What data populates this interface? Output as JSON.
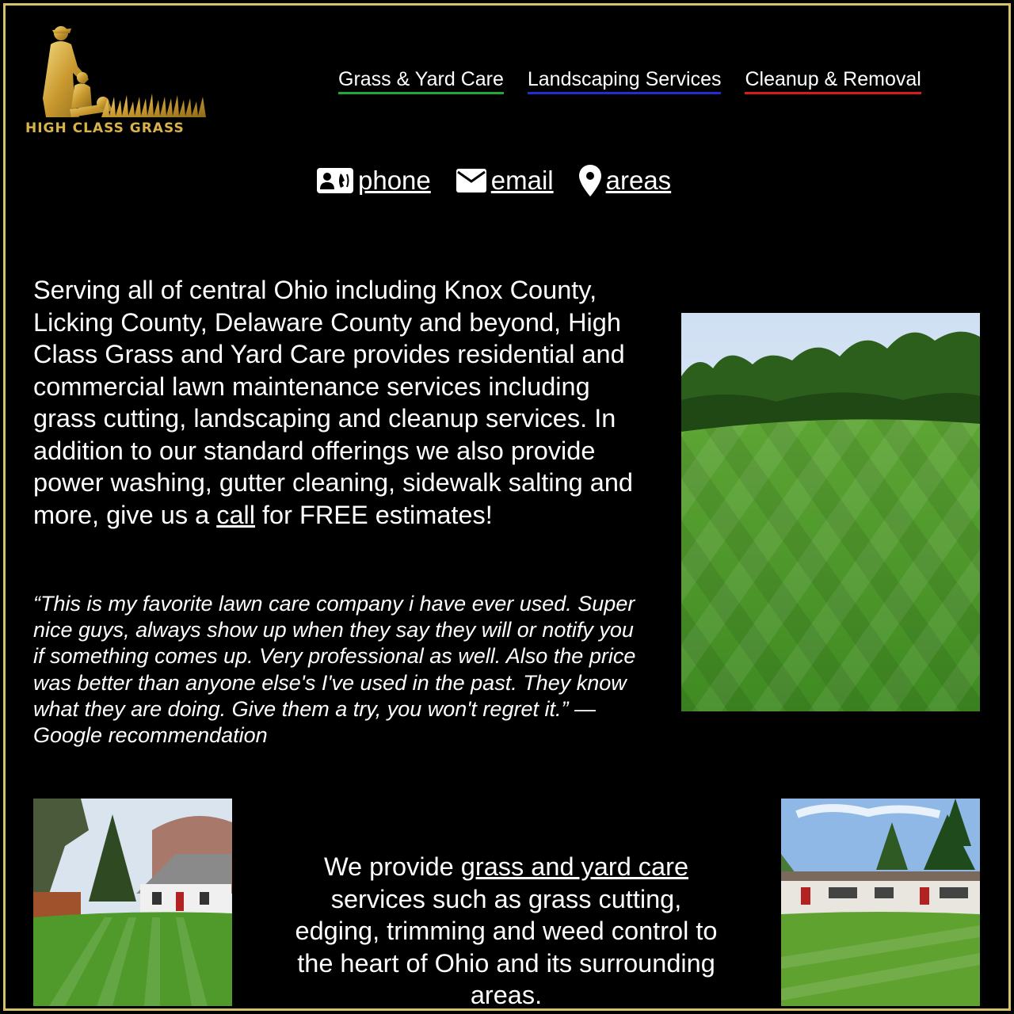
{
  "brand": {
    "logo_text": "HIGH CLASS GRASS",
    "accent_color": "#d6c06a"
  },
  "nav": {
    "items": [
      {
        "label": "Grass & Yard Care",
        "underline_color": "#1fa83a"
      },
      {
        "label": "Landscaping Services",
        "underline_color": "#1f2fd0"
      },
      {
        "label": "Cleanup & Removal",
        "underline_color": "#d81b1b"
      }
    ]
  },
  "contact": {
    "phone": {
      "icon": "contact-card-icon",
      "label": "phone"
    },
    "email": {
      "icon": "envelope-icon",
      "label": "email"
    },
    "areas": {
      "icon": "map-pin-icon",
      "label": "areas"
    }
  },
  "intro": {
    "text_before": "Serving all of central Ohio including Knox County, Licking County, Delaware County and beyond, High Class Grass and Yard Care provides residential and commercial lawn maintenance services including grass cutting, landscaping and cleanup services. In addition to our standard offerings we also provide power washing, gutter cleaning, sidewalk salting and more, give us a ",
    "link": "call",
    "text_after": " for FREE estimates!"
  },
  "testimonial": {
    "text": "“This is my favorite lawn care company i have ever used. Super nice guys, always show up when they say they will or notify you if something comes up. Very professional as well. Also the price was better than anyone else's I've used in the past. They know what they are doing. Give them a try, you won't regret it.” — Google recommendation"
  },
  "services": {
    "text_before": "We provide ",
    "link": "grass and yard care",
    "text_after": " services such as grass cutting, edging, trimming and weed control to the heart of Ohio and its surrounding areas."
  }
}
